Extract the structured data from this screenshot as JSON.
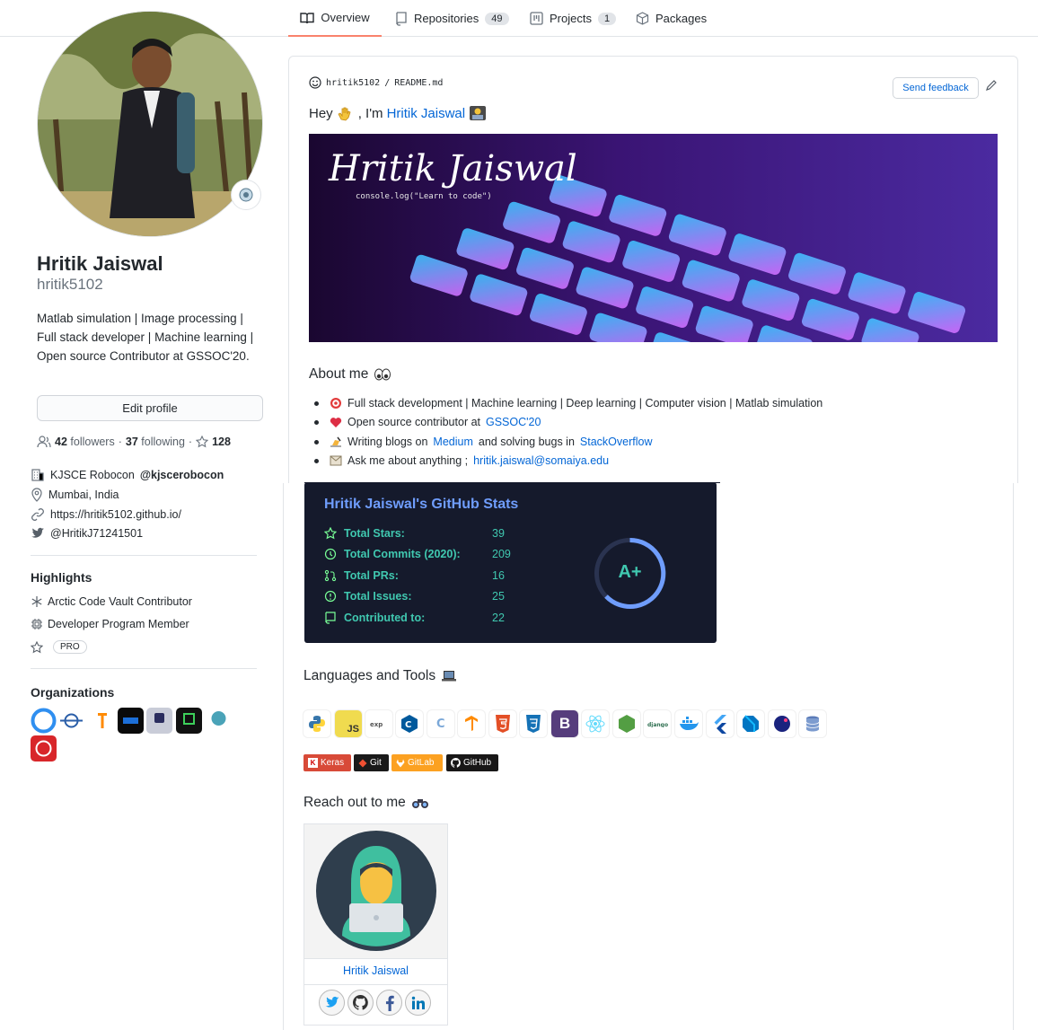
{
  "nav": {
    "tabs": [
      {
        "label": "Overview"
      },
      {
        "label": "Repositories",
        "count": "49"
      },
      {
        "label": "Projects",
        "count": "1"
      },
      {
        "label": "Packages"
      }
    ]
  },
  "profile": {
    "fullname": "Hritik Jaiswal",
    "username": "hritik5102",
    "bio": "Matlab simulation | Image processing | Full stack developer | Machine learning | Open source Contributor at GSSOC'20.",
    "edit_label": "Edit profile",
    "followers_count": "42",
    "followers_label": "followers",
    "following_count": "37",
    "following_label": "following",
    "stars": "128",
    "org_name": "KJSCE Robocon",
    "org_handle": "@kjscerobocon",
    "location": "Mumbai, India",
    "website": "https://hritik5102.github.io/",
    "twitter": "@HritikJ71241501"
  },
  "highlights": {
    "title": "Highlights",
    "items": [
      "Arctic Code Vault Contributor",
      "Developer Program Member"
    ],
    "pro": "PRO"
  },
  "organizations": {
    "title": "Organizations"
  },
  "readme": {
    "owner": "hritik5102",
    "file": "README.md",
    "feedback": "Send feedback",
    "greeting_prefix": "Hey",
    "greeting_mid": ", I'm",
    "greeting_name": "Hritik Jaiswal",
    "banner_title": "Hritik Jaiswal",
    "banner_sub": "console.log(\"Learn to code\")",
    "about_title": "About me",
    "bullets": {
      "b1": "Full stack development | Machine learning | Deep learning | Computer vision | Matlab simulation",
      "b2_pre": "Open source contributor at",
      "b2_link": "GSSOC'20",
      "b3_pre": "Writing blogs on",
      "b3_link1": "Medium",
      "b3_mid": "and solving bugs in",
      "b3_link2": "StackOverflow",
      "b4_pre": "Ask me about anything ;",
      "b4_link": "hritik.jaiswal@somaiya.edu"
    }
  },
  "stats": {
    "title": "Hritik Jaiswal's GitHub Stats",
    "rows": [
      {
        "label": "Total Stars:",
        "value": "39"
      },
      {
        "label": "Total Commits (2020):",
        "value": "209"
      },
      {
        "label": "Total PRs:",
        "value": "16"
      },
      {
        "label": "Total Issues:",
        "value": "25"
      },
      {
        "label": "Contributed to:",
        "value": "22"
      }
    ],
    "grade": "A+"
  },
  "tools": {
    "title": "Languages and Tools",
    "badges": [
      "Keras",
      "Git",
      "GitLab",
      "GitHub"
    ]
  },
  "reach": {
    "title": "Reach out to me",
    "name": "Hritik Jaiswal"
  },
  "colors": {
    "accent": "#0366d6",
    "tab_underline": "#f9826c",
    "stats_bg": "#151a2c",
    "stats_title": "#6f9dfc",
    "stats_text": "#40c8b0"
  }
}
